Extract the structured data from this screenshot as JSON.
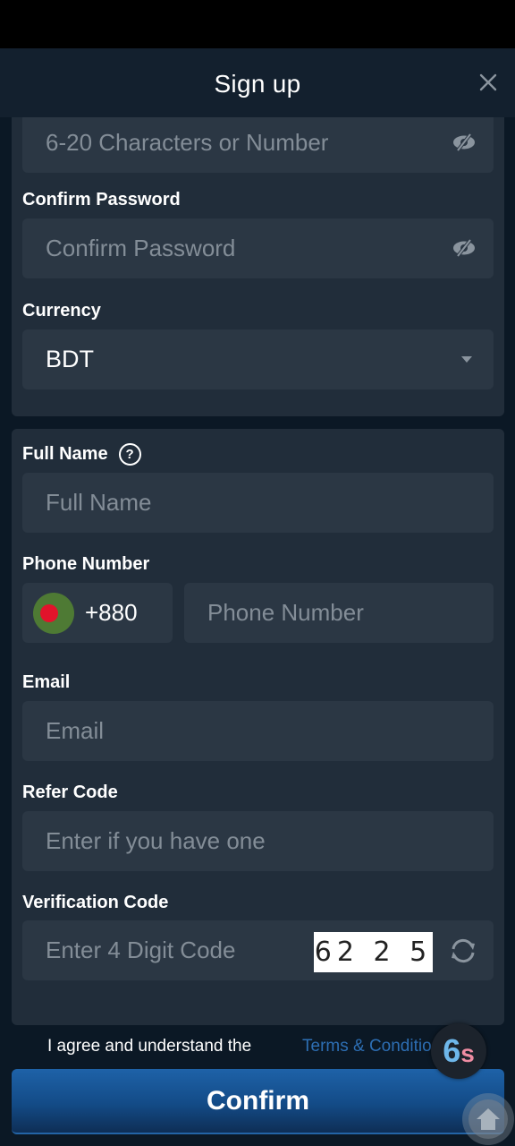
{
  "header": {
    "title": "Sign up"
  },
  "password_field": {
    "placeholder": "6-20 Characters or Number"
  },
  "confirm_password": {
    "label": "Confirm Password",
    "placeholder": "Confirm Password"
  },
  "currency": {
    "label": "Currency",
    "selected": "BDT"
  },
  "full_name": {
    "label": "Full Name",
    "placeholder": "Full Name",
    "help_icon": "?"
  },
  "phone": {
    "label": "Phone Number",
    "country_code": "+880",
    "placeholder": "Phone Number"
  },
  "email": {
    "label": "Email",
    "placeholder": "Email"
  },
  "refer_code": {
    "label": "Refer Code",
    "placeholder": "Enter if you have one"
  },
  "verification": {
    "label": "Verification Code",
    "placeholder": "Enter 4 Digit Code",
    "captcha": "6225"
  },
  "agreement": {
    "text": "I agree and understand the",
    "link": "Terms & Conditions"
  },
  "confirm_button": "Confirm",
  "badge": {
    "six": "6",
    "s": "s"
  },
  "colors": {
    "accent": "#1e62a8",
    "link": "#2d6eb3",
    "background": "#0b1825",
    "card": "#212d3a",
    "field": "#2b3744"
  }
}
